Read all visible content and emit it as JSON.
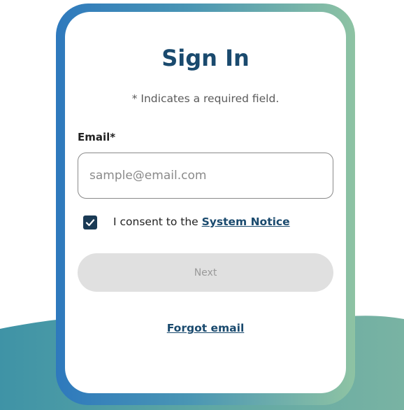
{
  "signin": {
    "title": "Sign In",
    "required_note": "* Indicates a required field.",
    "email_label": "Email*",
    "email_placeholder": "sample@email.com",
    "email_value": "",
    "consent_checked": true,
    "consent_text": "I consent to the ",
    "consent_link": "System Notice",
    "next_label": "Next",
    "next_enabled": false,
    "forgot_label": "Forgot email"
  },
  "colors": {
    "brand_dark": "#1a4a6e",
    "checkbox": "#1a3a55",
    "frame_gradient_start": "#2e79bd",
    "frame_gradient_end": "#8ec3a3",
    "button_disabled": "#e0e0e0"
  },
  "icons": {
    "checkbox_mark": "check-icon"
  }
}
